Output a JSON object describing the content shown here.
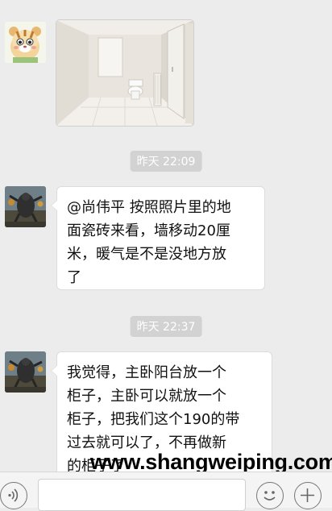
{
  "conversation": {
    "messages": [
      {
        "type": "image",
        "sender": "hamster-avatar",
        "image_desc": "bathroom-photo"
      },
      {
        "type": "timestamp",
        "text": "昨天 22:09"
      },
      {
        "type": "text",
        "sender": "contact",
        "lines": [
          "@尚伟平 按照照片里的地",
          "面瓷砖来看，墙移动20厘",
          "米，暖气是不是没地方放",
          "了"
        ]
      },
      {
        "type": "timestamp",
        "text": "昨天 22:37"
      },
      {
        "type": "text",
        "sender": "contact",
        "lines": [
          "我觉得，主卧阳台放一个",
          "柜子，主卧可以就放一个",
          "柜子，把我们这个190的带",
          "过去就可以了，不再做新",
          "的柜子了"
        ]
      }
    ]
  },
  "watermark": "www.shangweiping.com",
  "input_bar": {
    "voice_icon": "voice-icon",
    "emoji_icon": "emoji-icon",
    "plus_icon": "plus-icon",
    "input_value": ""
  }
}
